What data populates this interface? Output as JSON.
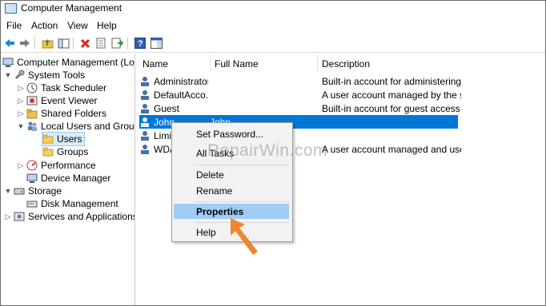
{
  "window": {
    "title": "Computer Management"
  },
  "menu": [
    "File",
    "Action",
    "View",
    "Help"
  ],
  "toolbar": {
    "icons": [
      "back-icon",
      "forward-icon",
      "up-folder-icon",
      "show-hide-tree-icon",
      "delete-icon",
      "properties-icon",
      "export-icon",
      "help-icon",
      "show-action-pane-icon"
    ]
  },
  "tree": {
    "root": "Computer Management (Local",
    "system_tools": "System Tools",
    "task_scheduler": "Task Scheduler",
    "event_viewer": "Event Viewer",
    "shared_folders": "Shared Folders",
    "local_users_groups": "Local Users and Groups",
    "users": "Users",
    "groups": "Groups",
    "performance": "Performance",
    "device_manager": "Device Manager",
    "storage": "Storage",
    "disk_management": "Disk Management",
    "services_apps": "Services and Applications"
  },
  "list": {
    "columns": [
      "Name",
      "Full Name",
      "Description"
    ],
    "rows": [
      {
        "name": "Administrator",
        "full": "",
        "desc": "Built-in account for administering..."
      },
      {
        "name": "DefaultAcco...",
        "full": "",
        "desc": "A user account managed by the s..."
      },
      {
        "name": "Guest",
        "full": "",
        "desc": "Built-in account for guest access t..."
      },
      {
        "name": "John",
        "full": "John",
        "desc": ""
      },
      {
        "name": "Limi",
        "full": "",
        "desc": ""
      },
      {
        "name": "WDA",
        "full": "",
        "desc": "A user account managed and use..."
      }
    ]
  },
  "context_menu": {
    "set_password": "Set Password...",
    "all_tasks": "All Tasks",
    "delete": "Delete",
    "rename": "Rename",
    "properties": "Properties",
    "help": "Help"
  },
  "watermark": "RepairWin.com",
  "colors": {
    "selection": "#0078d7",
    "menu_highlight": "#9fcdf5",
    "arrow": "#f0852d"
  }
}
